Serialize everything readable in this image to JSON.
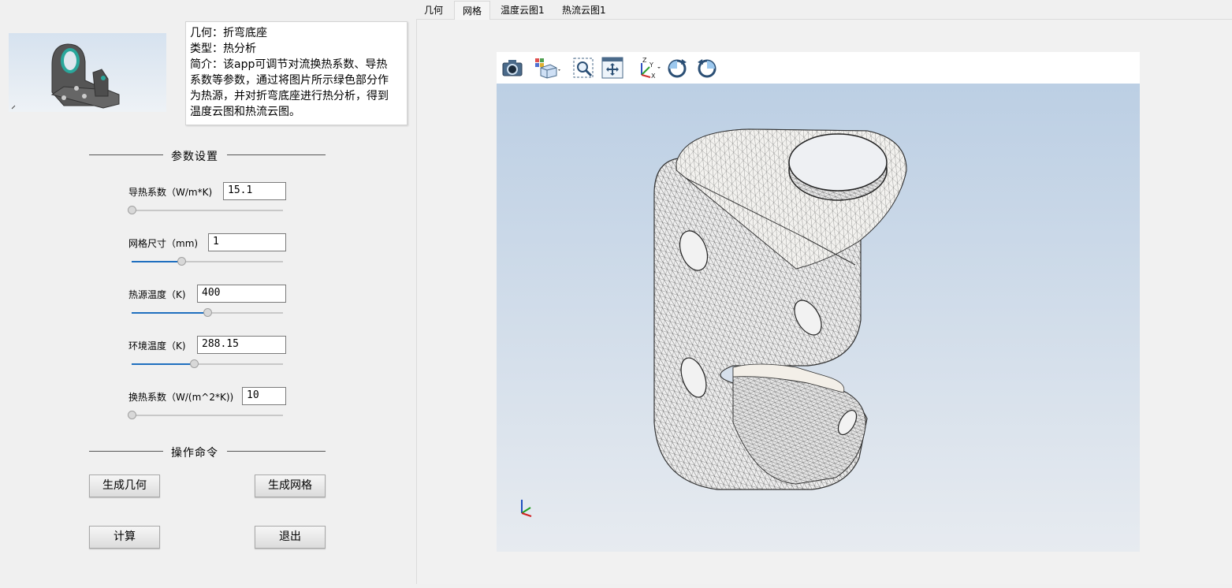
{
  "info": {
    "lines": [
      "几何：折弯底座",
      "类型：热分析",
      "简介：该app可调节对流换热系数、导热",
      "系数等参数，通过将图片所示绿色部分作",
      "为热源，并对折弯底座进行热分析，得到",
      "温度云图和热流云图。"
    ]
  },
  "sections": {
    "params": "参数设置",
    "commands": "操作命令"
  },
  "params": [
    {
      "label": "导热系数（W/m*K)",
      "value": "15.1",
      "slider": 0.0
    },
    {
      "label": "网格尺寸（mm)",
      "value": "1",
      "slider": 0.33
    },
    {
      "label": "热源温度（K)",
      "value": "400",
      "slider": 0.5
    },
    {
      "label": "环境温度（K)",
      "value": "288.15",
      "slider": 0.41
    },
    {
      "label": "换热系数（W/(m^2*K))",
      "value": "10",
      "slider": 0.0
    }
  ],
  "buttons": {
    "gen_geometry": "生成几何",
    "gen_mesh": "生成网格",
    "compute": "计算",
    "exit": "退出"
  },
  "tabs": [
    {
      "label": "几何",
      "active": false
    },
    {
      "label": "网格",
      "active": true
    },
    {
      "label": "温度云图1",
      "active": false
    },
    {
      "label": "热流云图1",
      "active": false
    }
  ],
  "toolbar_icons": [
    "camera-icon",
    "view-cube-icon",
    "zoom-box-icon",
    "fit-view-icon",
    "axis-orientation-icon",
    "rotate-ccw-icon",
    "rotate-cw-icon"
  ],
  "colors": {
    "accent": "#1f6fbf",
    "viewer_top": "#b9cde3",
    "viewer_bottom": "#e7ebf0",
    "thumb_part": "#555555",
    "thumb_highlight": "#2aa79b"
  }
}
